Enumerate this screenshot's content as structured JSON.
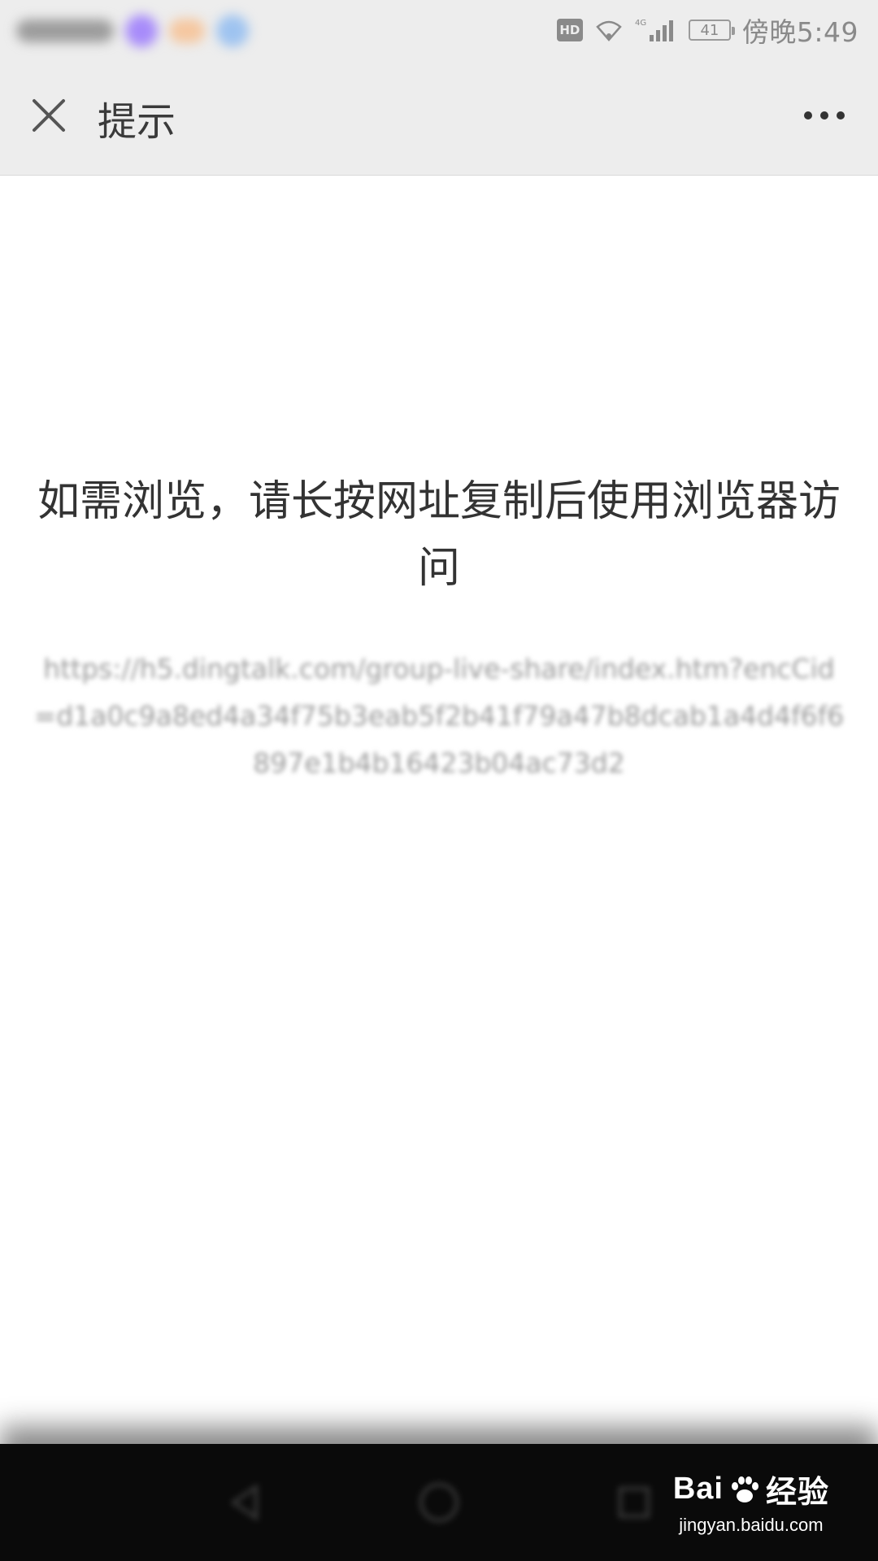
{
  "status_bar": {
    "clock": "傍晚5:49",
    "battery_level": "41",
    "hd_label": "HD",
    "network_label": "4G"
  },
  "nav_bar": {
    "title": "提示",
    "close_icon": "close-icon",
    "more_icon": "more-horizontal-icon"
  },
  "content": {
    "message": "如需浏览，请长按网址复制后使用浏览器访问",
    "url": "https://h5.dingtalk.com/group-live-share/index.htm?encCid=d1a0c9a8ed4a34f75b3eab5f2b41f79a47b8dcab1a4d4f6f6897e1b4b16423b04ac73d2"
  },
  "watermark": {
    "brand": "Bai",
    "brand_suffix": "经验",
    "url": "jingyan.baidu.com"
  },
  "colors": {
    "bar_bg": "#ededed",
    "text_primary": "#333333",
    "text_secondary": "#9a9a9a",
    "bottom_bar": "#0a0a0a"
  }
}
